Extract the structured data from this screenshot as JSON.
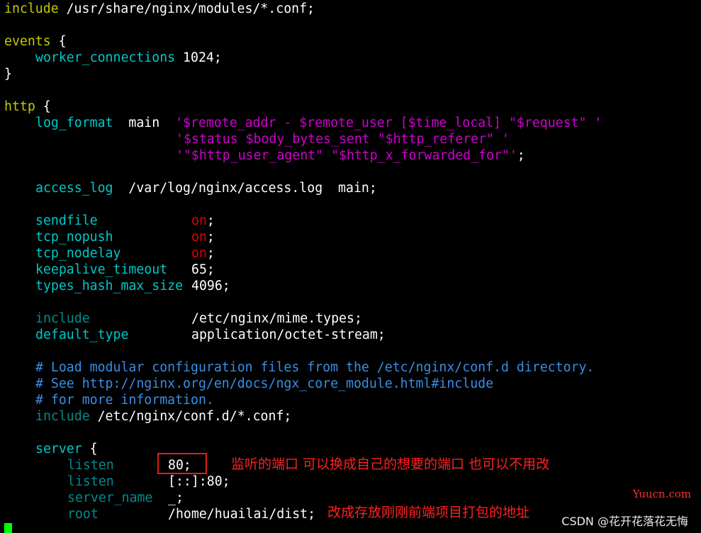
{
  "lines": {
    "l1": {
      "kw": "include",
      "rest": " /usr/share/nginx/modules/*.conf;"
    },
    "l3": {
      "kw": "events",
      "rest": " {"
    },
    "l4": {
      "dir": "worker_connections",
      "rest": " 1024;"
    },
    "l5": {
      "rest": "}"
    },
    "l7": {
      "kw": "http",
      "rest": " {"
    },
    "l8": {
      "dir": "log_format",
      "mid": "  main  ",
      "str": "'$remote_addr - $remote_user [$time_local] \"$request\" '"
    },
    "l9": {
      "str": "'$status $body_bytes_sent \"$http_referer\" '"
    },
    "l10": {
      "str": "'\"$http_user_agent\" \"$http_x_forwarded_for\"'",
      "tail": ";"
    },
    "l12": {
      "dir": "access_log",
      "rest": "  /var/log/nginx/access.log  main;"
    },
    "l14": {
      "dir": "sendfile",
      "val": "on",
      "tail": ";"
    },
    "l15": {
      "dir": "tcp_nopush",
      "val": "on",
      "tail": ";"
    },
    "l16": {
      "dir": "tcp_nodelay",
      "val": "on",
      "tail": ";"
    },
    "l17": {
      "dir": "keepalive_timeout",
      "rest": "65;"
    },
    "l18": {
      "dir": "types_hash_max_size",
      "rest": "4096;"
    },
    "l20": {
      "dir": "include",
      "rest": "/etc/nginx/mime.types;"
    },
    "l21": {
      "dir": "default_type",
      "rest": "application/octet-stream;"
    },
    "l23": {
      "cmt": "# Load modular configuration files from the /etc/nginx/conf.d directory."
    },
    "l24": {
      "cmt": "# See http://nginx.org/en/docs/ngx_core_module.html#include"
    },
    "l25": {
      "cmt": "# for more information."
    },
    "l26": {
      "dir": "include",
      "rest": " /etc/nginx/conf.d/*.conf;"
    },
    "l28": {
      "dir": "server",
      "rest": " {"
    },
    "l29": {
      "dir": "listen",
      "rest": "80;"
    },
    "l30": {
      "dir": "listen",
      "rest": "[::]:80;"
    },
    "l31": {
      "dir": "server_name",
      "rest": "_;"
    },
    "l32": {
      "dir": "root",
      "rest": "/home/huailai/dist;"
    }
  },
  "annotations": {
    "port_note": "监听的端口 可以换成自己的想要的端口 也可以不用改",
    "root_note": "改成存放刚刚前端项目打包的地址"
  },
  "watermarks": {
    "site": "Yuucn.com",
    "author": "CSDN @花开花落花无悔"
  },
  "colors": {
    "background": "#000000",
    "keyword": "#c8c800",
    "directive": "#00c8c8",
    "value_on": "#e00000",
    "string": "#d000d0",
    "comment": "#3a8ee6",
    "annotation": "#ff2020",
    "cursor": "#00ff00"
  }
}
